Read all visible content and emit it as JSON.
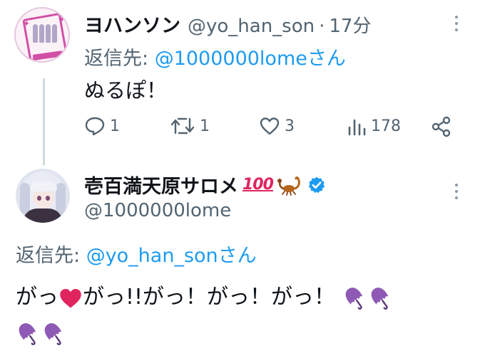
{
  "tweet1": {
    "display_name": "ヨハンソン",
    "handle": "@yo_han_son",
    "separator": "·",
    "time": "17分",
    "reply_label": "返信先: ",
    "reply_mention": "@1000000lomeさん",
    "text": "ぬるぽ！",
    "actions": {
      "replies": "1",
      "retweets": "1",
      "likes": "3",
      "views": "178"
    }
  },
  "tweet2": {
    "display_name": "壱百満天原サロメ",
    "name_emoji_1": "100",
    "handle": "@1000000lome",
    "reply_label": "返信先: ",
    "reply_mention": "@yo_han_sonさん",
    "text_part1": "がっ",
    "text_part2": "がっ!!がっ！がっ！がっ！",
    "inline_icons": [
      "heart-emoji",
      "scorpion-emoji",
      "verified-badge-icon",
      "umbrella-emoji"
    ]
  },
  "colors": {
    "link_blue": "#1d9bf0",
    "secondary_text": "#536471",
    "verified_blue": "#1d9bf0",
    "heart_red": "#e0245e"
  }
}
